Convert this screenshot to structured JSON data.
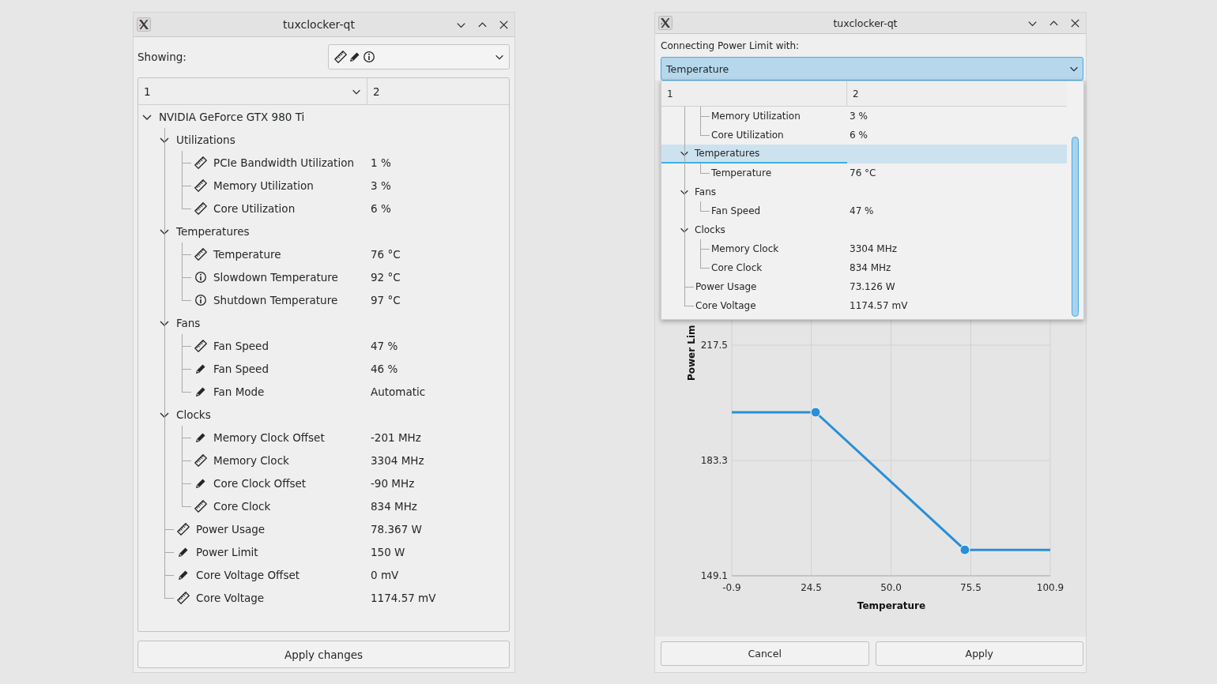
{
  "main_window": {
    "title": "tuxclocker-qt",
    "showing_label": "Showing:",
    "tree": {
      "columns": [
        "1",
        "2"
      ],
      "items": [
        {
          "label": "NVIDIA GeForce GTX 980 Ti",
          "expanded": true,
          "children": [
            {
              "label": "Utilizations",
              "expanded": true,
              "children": [
                {
                  "label": "PCIe Bandwidth Utilization",
                  "kind": "sensor",
                  "value": "1 %"
                },
                {
                  "label": "Memory Utilization",
                  "kind": "sensor",
                  "value": "3 %"
                },
                {
                  "label": "Core Utilization",
                  "kind": "sensor",
                  "value": "6 %"
                }
              ]
            },
            {
              "label": "Temperatures",
              "expanded": true,
              "children": [
                {
                  "label": "Temperature",
                  "kind": "sensor",
                  "value": "76 °C"
                },
                {
                  "label": "Slowdown Temperature",
                  "kind": "info",
                  "value": "92 °C"
                },
                {
                  "label": "Shutdown Temperature",
                  "kind": "info",
                  "value": "97 °C"
                }
              ]
            },
            {
              "label": "Fans",
              "expanded": true,
              "children": [
                {
                  "label": "Fan Speed",
                  "kind": "sensor",
                  "value": "47 %"
                },
                {
                  "label": "Fan Speed",
                  "kind": "editable",
                  "value": "46 %"
                },
                {
                  "label": "Fan Mode",
                  "kind": "editable",
                  "value": "Automatic"
                }
              ]
            },
            {
              "label": "Clocks",
              "expanded": true,
              "children": [
                {
                  "label": "Memory Clock Offset",
                  "kind": "editable",
                  "value": "-201 MHz"
                },
                {
                  "label": "Memory Clock",
                  "kind": "sensor",
                  "value": "3304 MHz"
                },
                {
                  "label": "Core Clock Offset",
                  "kind": "editable",
                  "value": "-90 MHz"
                },
                {
                  "label": "Core Clock",
                  "kind": "sensor",
                  "value": "834 MHz"
                }
              ]
            },
            {
              "label": "Power Usage",
              "kind": "sensor",
              "value": "78.367 W"
            },
            {
              "label": "Power Limit",
              "kind": "editable",
              "value": "150 W"
            },
            {
              "label": "Core Voltage Offset",
              "kind": "editable",
              "value": "0 mV"
            },
            {
              "label": "Core Voltage",
              "kind": "sensor",
              "value": "1174.57 mV"
            }
          ]
        }
      ]
    },
    "apply_button": "Apply changes"
  },
  "dialog_window": {
    "title": "tuxclocker-qt",
    "prompt": "Connecting Power Limit with:",
    "combo": {
      "value": "Temperature",
      "expanded": true
    },
    "popup": {
      "columns": [
        "1",
        "2"
      ],
      "items": [
        {
          "children": [
            {
              "children": [
                {
                  "label": "Memory Utilization",
                  "value": "3 %",
                  "selected": false
                },
                {
                  "label": "Core Utilization",
                  "value": "6 %",
                  "selected": false
                }
              ]
            },
            {
              "label": "Temperatures",
              "expanded": true,
              "selected": true,
              "children": [
                {
                  "label": "Temperature",
                  "value": "76 °C",
                  "selected": false
                }
              ]
            },
            {
              "label": "Fans",
              "expanded": true,
              "selected": false,
              "children": [
                {
                  "label": "Fan Speed",
                  "value": "47 %",
                  "selected": false
                }
              ]
            },
            {
              "label": "Clocks",
              "expanded": true,
              "selected": false,
              "children": [
                {
                  "label": "Memory Clock",
                  "value": "3304 MHz",
                  "selected": false
                },
                {
                  "label": "Core Clock",
                  "value": "834 MHz",
                  "selected": false
                }
              ]
            },
            {
              "label": "Power Usage",
              "value": "73.126 W",
              "selected": false
            },
            {
              "label": "Core Voltage",
              "value": "1174.57 mV",
              "selected": false
            }
          ]
        }
      ]
    },
    "chart_data": {
      "type": "line",
      "xlabel": "Temperature",
      "ylabel": "Power Lim",
      "x": [
        -0.9,
        25.9,
        73.6,
        100.9
      ],
      "series": [
        {
          "color": "#2a8fd6",
          "values": [
            197.6,
            197.6,
            156.8,
            156.8
          ]
        }
      ],
      "grid": true,
      "xlim": [
        -0.9,
        100.9
      ],
      "ylim": [
        149.1,
        251.7
      ],
      "xticks": [
        -0.9,
        24.5,
        {
          "value": 50,
          "label": "50.0"
        },
        75.5,
        100.9
      ],
      "yticks": [
        149.1,
        183.3,
        217.5
      ]
    },
    "buttons": [
      "Cancel",
      "Apply"
    ]
  }
}
